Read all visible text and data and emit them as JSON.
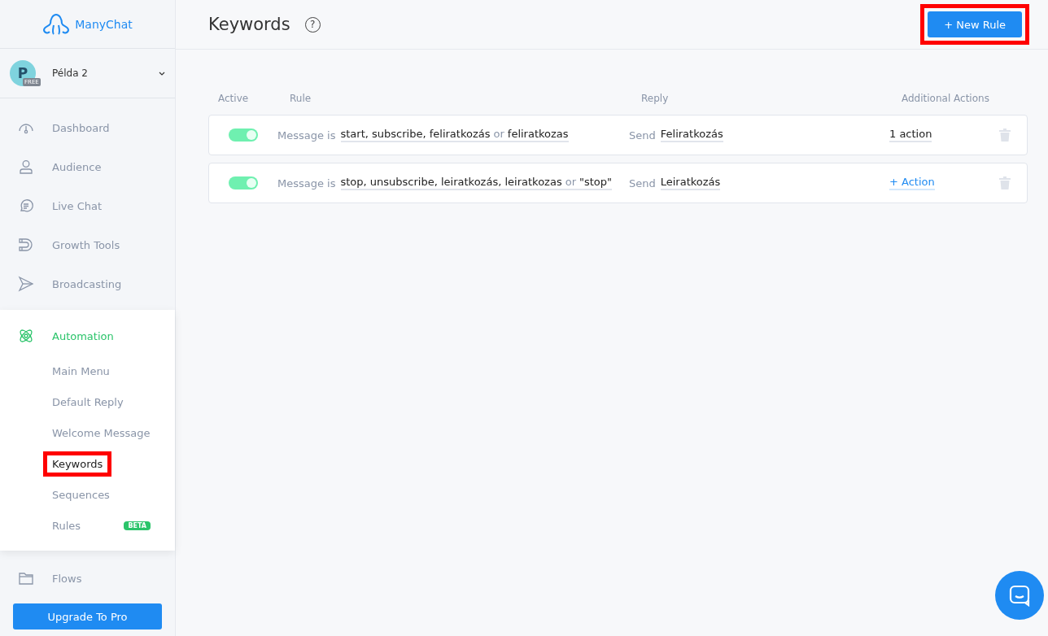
{
  "sidebar": {
    "logo": "ManyChat",
    "account": {
      "initial": "P",
      "plan": "FREE",
      "name": "Példa 2"
    },
    "nav": [
      {
        "label": "Dashboard",
        "selected": false
      },
      {
        "label": "Audience",
        "selected": false
      },
      {
        "label": "Live Chat",
        "selected": false
      },
      {
        "label": "Growth Tools",
        "selected": false
      },
      {
        "label": "Broadcasting",
        "selected": false
      },
      {
        "label": "Automation",
        "selected": true,
        "children": [
          {
            "label": "Main Menu",
            "selected": false,
            "highlighted": false
          },
          {
            "label": "Default Reply",
            "selected": false,
            "highlighted": false
          },
          {
            "label": "Welcome Message",
            "selected": false,
            "highlighted": false
          },
          {
            "label": "Keywords",
            "selected": true,
            "highlighted": true
          },
          {
            "label": "Sequences",
            "selected": false,
            "highlighted": false
          },
          {
            "label": "Rules",
            "selected": false,
            "highlighted": false,
            "badge": "BETA"
          }
        ]
      },
      {
        "label": "Flows",
        "selected": false
      }
    ],
    "upgrade_button": "Upgrade To Pro"
  },
  "header": {
    "title": "Keywords",
    "help": "?",
    "new_rule_button": {
      "label": "+ New Rule",
      "highlighted": true
    }
  },
  "table": {
    "columns": [
      "Active",
      "Rule",
      "Reply",
      "Additional Actions"
    ],
    "rows": [
      {
        "active": true,
        "condition": "Message is",
        "terms": [
          {
            "kind": "keyword",
            "text": "start, subscribe, feliratkozás"
          },
          {
            "kind": "joiner",
            "text": "or"
          },
          {
            "kind": "keyword",
            "text": "feliratkozas"
          }
        ],
        "reply_label": "Send",
        "reply": "Feliratkozás",
        "action": {
          "kind": "count",
          "text": "1 action"
        }
      },
      {
        "active": true,
        "condition": "Message is",
        "terms": [
          {
            "kind": "keyword",
            "text": "stop, unsubscribe, leiratkozás, leiratkozas"
          },
          {
            "kind": "joiner",
            "text": "or"
          },
          {
            "kind": "keyword",
            "text": "\"stop\""
          }
        ],
        "reply_label": "Send",
        "reply": "Leiratkozás",
        "action": {
          "kind": "add",
          "text": "+ Action"
        }
      }
    ]
  }
}
